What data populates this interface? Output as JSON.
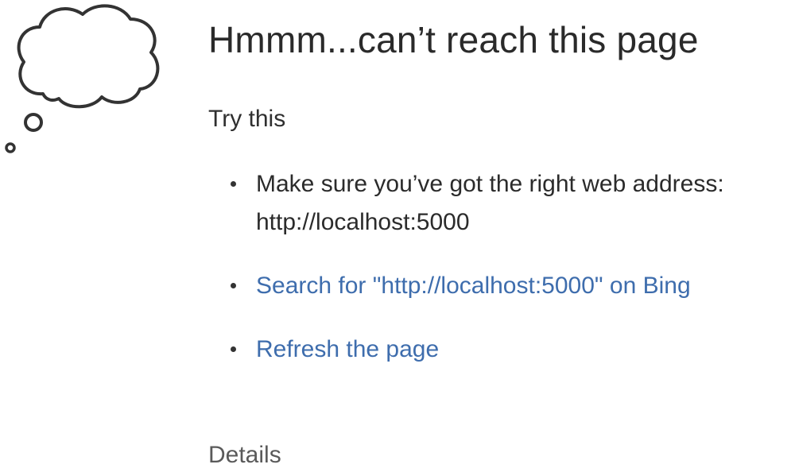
{
  "icon": "thought-bubble-icon",
  "title": "Hmmm...can’t reach this page",
  "try_heading": "Try this",
  "suggestions": {
    "check_address": {
      "prefix": "Make sure you’ve got the right web address: ",
      "url": "http://localhost:5000"
    },
    "search": "Search for \"http://localhost:5000\" on Bing",
    "refresh": "Refresh the page"
  },
  "details": "Details",
  "colors": {
    "text": "#2b2b2b",
    "link": "#3e6dad",
    "muted": "#5a5a5a"
  }
}
